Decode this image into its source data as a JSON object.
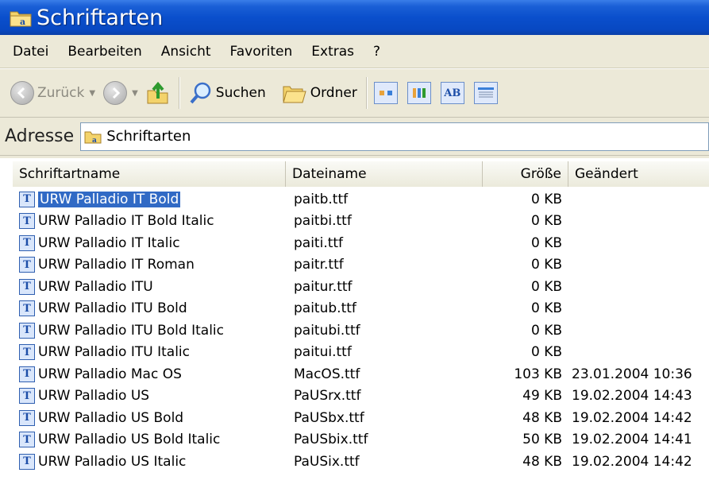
{
  "window": {
    "title": "Schriftarten"
  },
  "menu": {
    "items": [
      "Datei",
      "Bearbeiten",
      "Ansicht",
      "Favoriten",
      "Extras",
      "?"
    ]
  },
  "toolbar": {
    "back_label": "Zurück",
    "search_label": "Suchen",
    "folders_label": "Ordner"
  },
  "address": {
    "label": "Adresse",
    "value": "Schriftarten"
  },
  "list": {
    "columns": [
      "Schriftartname",
      "Dateiname",
      "Größe",
      "Geändert"
    ],
    "rows": [
      {
        "name": "URW Palladio IT Bold",
        "file": "paitb.ttf",
        "size": "0 KB",
        "modified": ""
      },
      {
        "name": "URW Palladio IT Bold Italic",
        "file": "paitbi.ttf",
        "size": "0 KB",
        "modified": ""
      },
      {
        "name": "URW Palladio IT Italic",
        "file": "paiti.ttf",
        "size": "0 KB",
        "modified": ""
      },
      {
        "name": "URW Palladio IT Roman",
        "file": "paitr.ttf",
        "size": "0 KB",
        "modified": ""
      },
      {
        "name": "URW Palladio ITU",
        "file": "paitur.ttf",
        "size": "0 KB",
        "modified": ""
      },
      {
        "name": "URW Palladio ITU Bold",
        "file": "paitub.ttf",
        "size": "0 KB",
        "modified": ""
      },
      {
        "name": "URW Palladio ITU Bold Italic",
        "file": "paitubi.ttf",
        "size": "0 KB",
        "modified": ""
      },
      {
        "name": "URW Palladio ITU Italic",
        "file": "paitui.ttf",
        "size": "0 KB",
        "modified": ""
      },
      {
        "name": "URW Palladio Mac OS",
        "file": "MacOS.ttf",
        "size": "103 KB",
        "modified": "23.01.2004 10:36"
      },
      {
        "name": "URW Palladio US",
        "file": "PaUSrx.ttf",
        "size": "49 KB",
        "modified": "19.02.2004 14:43"
      },
      {
        "name": "URW Palladio US Bold",
        "file": "PaUSbx.ttf",
        "size": "48 KB",
        "modified": "19.02.2004 14:42"
      },
      {
        "name": "URW Palladio US Bold Italic",
        "file": "PaUSbix.ttf",
        "size": "50 KB",
        "modified": "19.02.2004 14:41"
      },
      {
        "name": "URW Palladio US Italic",
        "file": "PaUSix.ttf",
        "size": "48 KB",
        "modified": "19.02.2004 14:42"
      }
    ],
    "selected_index": 0
  }
}
